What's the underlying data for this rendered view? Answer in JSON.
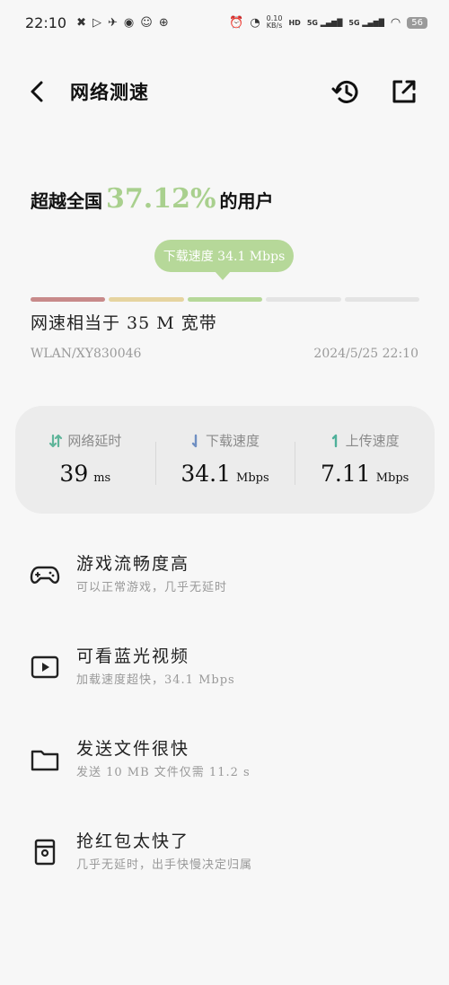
{
  "status_bar": {
    "time": "22:10",
    "net_speed_value": "0.10",
    "net_speed_unit": "KB/s",
    "hd_label": "HD",
    "sim1": "5G",
    "sim2": "5G",
    "battery": "56"
  },
  "header": {
    "title": "网络测速",
    "back_icon": "back-arrow-icon",
    "history_icon": "history-icon",
    "share_icon": "share-external-icon"
  },
  "result": {
    "rank_prefix": "超越全国",
    "rank_percent": "37.12%",
    "rank_suffix": "的用户",
    "tooltip": "下载速度 34.1 Mbps",
    "scale_colors": [
      "#c88a8a",
      "#e6d4a0",
      "#b6d899",
      "#e4e4e4",
      "#e4e4e4"
    ],
    "highlight_color": "#a9d08e",
    "equivalent": "网速相当于 35 M 宽带",
    "network": "WLAN/XY830046",
    "datetime": "2024/5/25 22:10"
  },
  "stats": [
    {
      "label": "网络延时",
      "value": "39",
      "unit": "ms",
      "icon": "latency-arrows-icon",
      "color": "#5fb59a"
    },
    {
      "label": "下载速度",
      "value": "34.1",
      "unit": "Mbps",
      "icon": "download-arrow-icon",
      "color": "#6f8fc2"
    },
    {
      "label": "上传速度",
      "value": "7.11",
      "unit": "Mbps",
      "icon": "upload-arrow-icon",
      "color": "#4fb09a"
    }
  ],
  "features": [
    {
      "title": "游戏流畅度高",
      "subtitle": "可以正常游戏，几乎无延时",
      "icon": "gamepad-icon"
    },
    {
      "title": "可看蓝光视频",
      "subtitle": "加载速度超快，34.1 Mbps",
      "icon": "video-play-icon"
    },
    {
      "title": "发送文件很快",
      "subtitle": "发送 10 MB 文件仅需 11.2 s",
      "icon": "folder-icon"
    },
    {
      "title": "抢红包太快了",
      "subtitle": "几乎无延时，出手快慢决定归属",
      "icon": "red-packet-icon"
    }
  ]
}
